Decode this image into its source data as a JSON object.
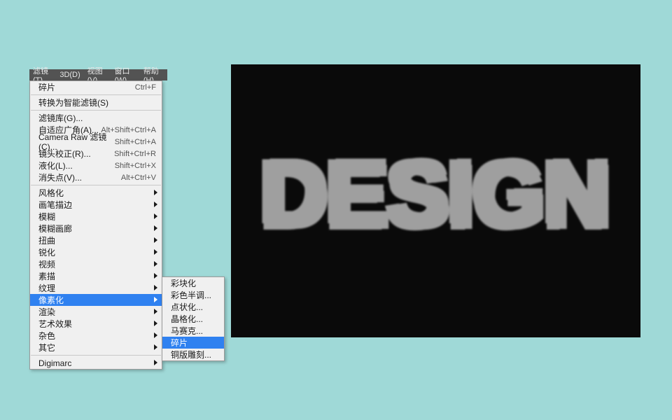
{
  "menubar": {
    "items": [
      {
        "label": "滤镜(T)"
      },
      {
        "label": "3D(D)"
      },
      {
        "label": "视图(V)"
      },
      {
        "label": "窗口(W)"
      },
      {
        "label": "帮助(H)"
      }
    ]
  },
  "menu": {
    "groups": [
      [
        {
          "label": "碎片",
          "shortcut": "Ctrl+F"
        }
      ],
      [
        {
          "label": "转换为智能滤镜(S)"
        }
      ],
      [
        {
          "label": "滤镜库(G)..."
        },
        {
          "label": "自适应广角(A)...",
          "shortcut": "Alt+Shift+Ctrl+A"
        },
        {
          "label": "Camera Raw 滤镜(C)...",
          "shortcut": "Shift+Ctrl+A"
        },
        {
          "label": "镜头校正(R)...",
          "shortcut": "Shift+Ctrl+R"
        },
        {
          "label": "液化(L)...",
          "shortcut": "Shift+Ctrl+X"
        },
        {
          "label": "消失点(V)...",
          "shortcut": "Alt+Ctrl+V"
        }
      ],
      [
        {
          "label": "风格化",
          "sub": true
        },
        {
          "label": "画笔描边",
          "sub": true
        },
        {
          "label": "模糊",
          "sub": true
        },
        {
          "label": "模糊画廊",
          "sub": true
        },
        {
          "label": "扭曲",
          "sub": true
        },
        {
          "label": "锐化",
          "sub": true
        },
        {
          "label": "视频",
          "sub": true
        },
        {
          "label": "素描",
          "sub": true
        },
        {
          "label": "纹理",
          "sub": true
        },
        {
          "label": "像素化",
          "sub": true,
          "selected": true
        },
        {
          "label": "渲染",
          "sub": true
        },
        {
          "label": "艺术效果",
          "sub": true
        },
        {
          "label": "杂色",
          "sub": true
        },
        {
          "label": "其它",
          "sub": true
        }
      ],
      [
        {
          "label": "Digimarc",
          "sub": true
        }
      ]
    ]
  },
  "submenu": {
    "items": [
      {
        "label": "彩块化"
      },
      {
        "label": "彩色半调..."
      },
      {
        "label": "点状化..."
      },
      {
        "label": "晶格化..."
      },
      {
        "label": "马赛克..."
      },
      {
        "label": "碎片",
        "selected": true
      },
      {
        "label": "铜版雕刻..."
      }
    ]
  },
  "preview": {
    "text": "DESIGN"
  }
}
